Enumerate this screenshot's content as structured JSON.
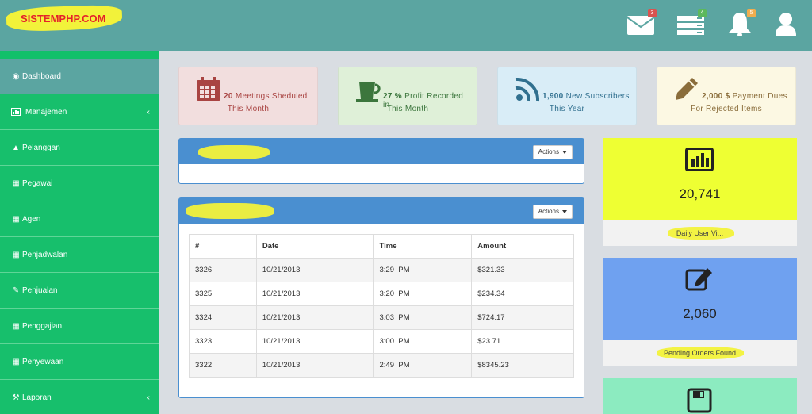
{
  "header": {
    "logo_text": "SISTEMPHP.COM",
    "icons": [
      {
        "name": "mail-icon",
        "badge": "3",
        "badge_color": "#d9534f"
      },
      {
        "name": "tasks-icon",
        "badge": "4",
        "badge_color": "#5cb85c"
      },
      {
        "name": "bell-icon",
        "badge": "5",
        "badge_color": "#f0ad4e"
      },
      {
        "name": "user-icon",
        "badge": null
      }
    ]
  },
  "sidebar": {
    "items": [
      {
        "label": "Dashboard",
        "icon": "dashboard-icon",
        "active": true
      },
      {
        "label": "Manajemen",
        "icon": "chart-icon",
        "has_chevron": true
      },
      {
        "label": "Pelanggan",
        "icon": "flask-icon"
      },
      {
        "label": "Pegawai",
        "icon": "table-icon"
      },
      {
        "label": "Agen",
        "icon": "table-icon"
      },
      {
        "label": "Penjadwalan",
        "icon": "table-icon"
      },
      {
        "label": "Penjualan",
        "icon": "edit-icon"
      },
      {
        "label": "Penggajian",
        "icon": "table-icon"
      },
      {
        "label": "Penyewaan",
        "icon": "table-icon"
      },
      {
        "label": "Laporan",
        "icon": "wrench-icon",
        "has_chevron": true
      }
    ]
  },
  "stats": [
    {
      "value": "20",
      "text": "Meetings Sheduled",
      "line2": "This Month",
      "icon": "calendar-icon",
      "bg": "#f2dede",
      "color": "#a94442"
    },
    {
      "value": "27 %",
      "text": "Profit Recorded in",
      "line2": "This Month",
      "icon": "coffee-icon",
      "bg": "#dff0d8",
      "color": "#3c763d"
    },
    {
      "value": "1,900",
      "text": "New Subscribers",
      "line2": "This Year",
      "icon": "rss-icon",
      "bg": "#d9edf7",
      "color": "#31708f"
    },
    {
      "value": "2,000 $",
      "text": "Payment Dues",
      "line2": "For Rejected Items",
      "icon": "pencil-icon",
      "bg": "#fcf8e3",
      "color": "#8a6d3b"
    }
  ],
  "panels": {
    "actions_label": "Actions",
    "table": {
      "columns": [
        "#",
        "Date",
        "Time",
        "Amount"
      ],
      "rows": [
        [
          "3326",
          "10/21/2013",
          "3:29  PM",
          "$321.33"
        ],
        [
          "3325",
          "10/21/2013",
          "3:20  PM",
          "$234.34"
        ],
        [
          "3324",
          "10/21/2013",
          "3:03  PM",
          "$724.17"
        ],
        [
          "3323",
          "10/21/2013",
          "3:00  PM",
          "$23.71"
        ],
        [
          "3322",
          "10/21/2013",
          "2:49  PM",
          "$8345.23"
        ]
      ]
    }
  },
  "cards": [
    {
      "value": "20,741",
      "label": "Daily User Vi...",
      "icon": "bar-chart-icon",
      "bg": "#eeff33"
    },
    {
      "value": "2,060",
      "label": "Pending Orders Found",
      "icon": "edit-square-icon",
      "bg": "#6fa1f0"
    },
    {
      "value": "",
      "label": "",
      "icon": "save-icon",
      "bg": "#8cebc0"
    }
  ]
}
